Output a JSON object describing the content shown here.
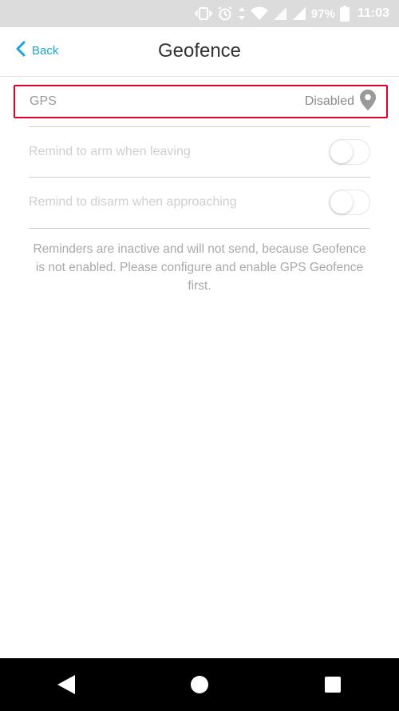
{
  "status_bar": {
    "battery": "97%",
    "time": "11:03"
  },
  "header": {
    "back_label": "Back",
    "title": "Geofence"
  },
  "gps": {
    "label": "GPS",
    "value": "Disabled"
  },
  "settings": [
    {
      "label": "Remind to arm when leaving",
      "enabled": false
    },
    {
      "label": "Remind to disarm when approaching",
      "enabled": false
    }
  ],
  "notice": "Reminders are inactive and will not send, because Geofence is not enabled. Please configure and enable GPS Geofence first.",
  "colors": {
    "accent": "#1ba3d9",
    "highlight": "#e0002a"
  }
}
